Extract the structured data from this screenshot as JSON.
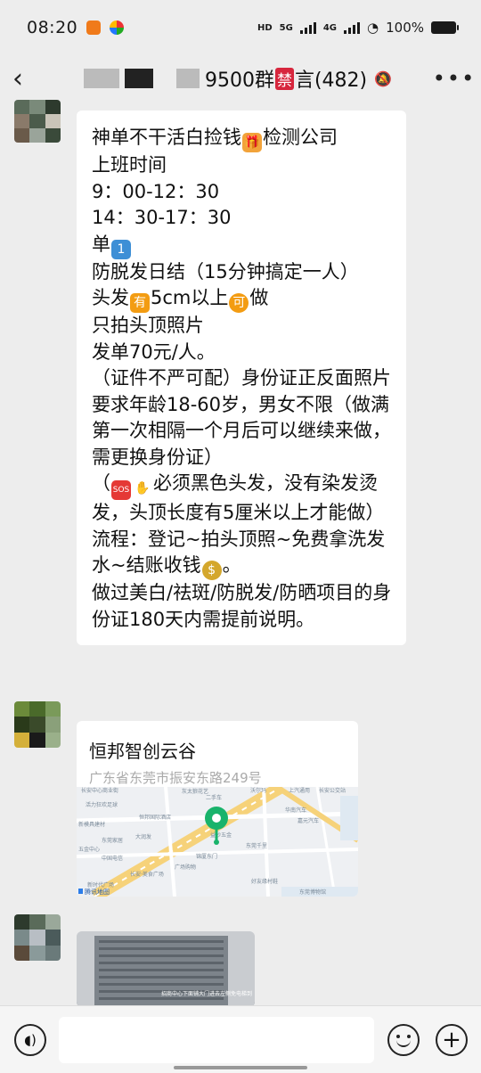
{
  "status_bar": {
    "time": "08:20",
    "network_labels": [
      "5G",
      "4G"
    ],
    "battery": "100%"
  },
  "header": {
    "title_visible_part": "9500群",
    "title_ban_char": "禁",
    "title_tail": "言(482)",
    "back_icon": "chevron-left-icon",
    "more_icon": "more-dots-icon"
  },
  "message1": {
    "lines": [
      "神单不干活白捡钱🎁检测公司",
      "上班时间",
      "9：00-12：30",
      "14：30-17：30",
      "单1️⃣防脱发日结（15分钟搞定一人）",
      "头发🈶5cm以上🉑做",
      "只拍头顶照片",
      "发单70元/人。",
      "（证件不严可配）身份证正反面照片",
      "要求年龄18-60岁，男女不限（做满第一次相隔一个月后可以继续来做，需更换身份证）",
      "（🆘👋必须黑色头发，没有染发烫发，头顶长度有5厘米以上才能做）",
      "流程：登记~拍头顶照~免费拿洗发水~结账收钱💰。",
      "做过美白/祛斑/防脱发/防晒项目的身份证180天内需提前说明。"
    ]
  },
  "message2": {
    "location_name": "恒邦智创云谷",
    "location_address": "广东省东莞市振安东路249号",
    "map_labels": [
      "灰太狼花艺",
      "二手车",
      "长安中心商业街",
      "沃尔玛",
      "上汽通用",
      "长安公交站",
      "活力狂欢足球",
      "新模具建材",
      "恒邦国际酒店",
      "华南汽车",
      "嘉元汽车",
      "东莞家居",
      "大润发",
      "益砂五金",
      "东莞千里",
      "中国电信",
      "长安·美食广场",
      "广场购物",
      "五金中心",
      "腾讯地图",
      "新时代广场",
      "锦厦东门",
      "好友缘村鞋",
      "东莞博物馆"
    ],
    "map_pin_icon": "location-pin-icon",
    "map_logo": "腾讯地图"
  },
  "message3": {
    "image_caption": "招商中心下面铺大门进去左侧免电梯到"
  },
  "input_bar": {
    "voice_icon": "voice-icon",
    "emoji_icon": "emoji-icon",
    "plus_icon": "plus-icon"
  },
  "colors": {
    "background": "#ededed",
    "bubble": "#ffffff",
    "ban_badge": "#d7263d",
    "map_pin": "#19b36b"
  }
}
